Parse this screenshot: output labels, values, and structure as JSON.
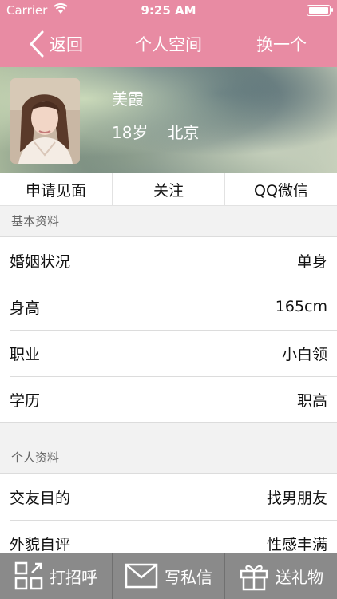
{
  "status_bar": {
    "carrier": "Carrier",
    "time": "9:25 AM"
  },
  "nav": {
    "back_label": "返回",
    "title": "个人空间",
    "switch_label": "换一个"
  },
  "profile": {
    "name": "美霞",
    "age": "18岁",
    "city": "北京"
  },
  "actions": [
    "申请见面",
    "关注",
    "QQ微信"
  ],
  "basic_section": {
    "title": "基本资料",
    "rows": [
      {
        "label": "婚姻状况",
        "value": "单身"
      },
      {
        "label": "身高",
        "value": "165cm"
      },
      {
        "label": "职业",
        "value": "小白领"
      },
      {
        "label": "学历",
        "value": "职高"
      }
    ]
  },
  "personal_section": {
    "title": "个人资料",
    "rows": [
      {
        "label": "交友目的",
        "value": "找男朋友"
      },
      {
        "label": "外貌自评",
        "value": "性感丰满"
      }
    ]
  },
  "tabs": [
    {
      "label": "打招呼",
      "icon": "greet-grid-icon"
    },
    {
      "label": "写私信",
      "icon": "envelope-icon"
    },
    {
      "label": "送礼物",
      "icon": "gift-icon"
    }
  ],
  "colors": {
    "accent": "#e88ba3",
    "tab_bar": "#8a8a8a"
  }
}
